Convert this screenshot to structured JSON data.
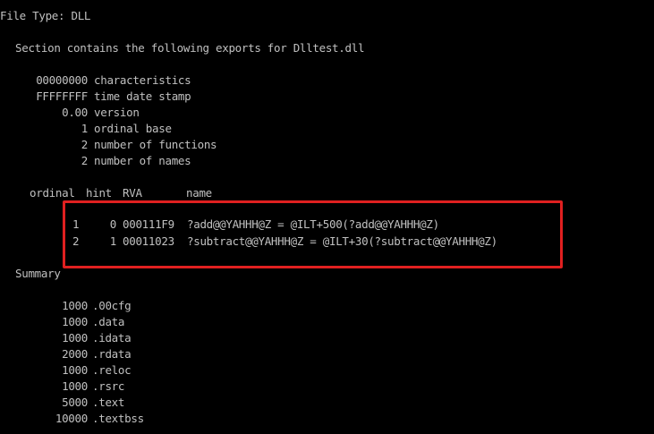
{
  "console": {
    "text_color": "#c0c0c0",
    "background": "#000000",
    "highlight_color": "#e02020",
    "file_type": "File Type: DLL",
    "section_header": "Section contains the following exports for Dlltest.dll",
    "header_fields": [
      {
        "value": "00000000",
        "label": "characteristics"
      },
      {
        "value": "FFFFFFFF",
        "label": "time date stamp"
      },
      {
        "value": "0.00",
        "label": "version"
      },
      {
        "value": "1",
        "label": "ordinal base"
      },
      {
        "value": "2",
        "label": "number of functions"
      },
      {
        "value": "2",
        "label": "number of names"
      }
    ],
    "exports_table": {
      "headers": {
        "ordinal": "ordinal",
        "hint": "hint",
        "rva": "RVA",
        "name": "name"
      },
      "rows": [
        {
          "ordinal": "1",
          "hint": "0",
          "rva": "000111F9",
          "name": "?add@@YAHHH@Z = @ILT+500(?add@@YAHHH@Z)"
        },
        {
          "ordinal": "2",
          "hint": "1",
          "rva": "00011023",
          "name": "?subtract@@YAHHH@Z = @ILT+30(?subtract@@YAHHH@Z)"
        }
      ]
    },
    "summary_title": "Summary",
    "summary": [
      {
        "size": "1000",
        "section": ".00cfg"
      },
      {
        "size": "1000",
        "section": ".data"
      },
      {
        "size": "1000",
        "section": ".idata"
      },
      {
        "size": "2000",
        "section": ".rdata"
      },
      {
        "size": "1000",
        "section": ".reloc"
      },
      {
        "size": "1000",
        "section": ".rsrc"
      },
      {
        "size": "5000",
        "section": ".text"
      },
      {
        "size": "10000",
        "section": ".textbss"
      }
    ]
  }
}
